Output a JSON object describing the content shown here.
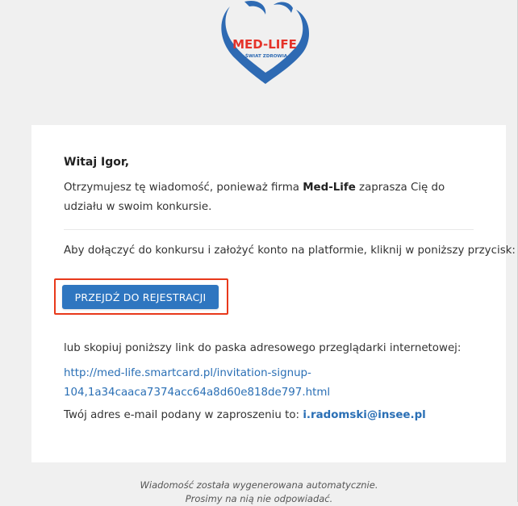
{
  "logo": {
    "brand": "MED-LIFE",
    "tagline": "ŚWIAT ZDROWIA",
    "colors": {
      "heart": "#2e6ab3",
      "brand": "#e5332a"
    }
  },
  "email": {
    "greeting": "Witaj Igor,",
    "intro_prefix": "Otrzymujesz tę wiadomość, ponieważ firma ",
    "intro_company": "Med-Life",
    "intro_suffix": " zaprasza Cię do udziału w swoim konkursie.",
    "instruction": "Aby dołączyć do konkursu i założyć konto na platformie, kliknij w poniższy przycisk:",
    "cta_label": "PRZEJDŹ DO REJESTRACJI",
    "copy_instruction": "lub skopiuj poniższy link do paska adresowego przeglądarki internetowej:",
    "link_line1": "http://med-life.smartcard.pl/invitation-signup-",
    "link_line2": "104,1a34caaca7374acc64a8d60e818de797.html",
    "email_prefix": "Twój adres e-mail podany w zaproszeniu to: ",
    "email_address": "i.radomski@insee.pl"
  },
  "footer": {
    "line1": "Wiadomość została wygenerowana automatycznie.",
    "line2": "Prosimy na nią nie odpowiadać."
  },
  "colors": {
    "button": "#2f76c0",
    "link": "#2a6fb5",
    "highlight": "#e8391b",
    "background": "#f0f0f0"
  }
}
